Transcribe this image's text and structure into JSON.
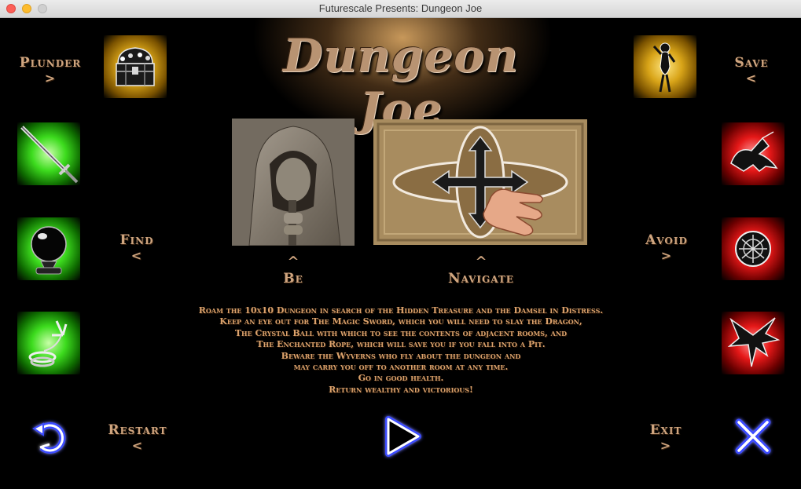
{
  "window": {
    "title": "Futurescale Presents: Dungeon Joe"
  },
  "game": {
    "title": "Dungeon Joe"
  },
  "labels": {
    "plunder": "Plunder",
    "plunder_arrow": ">",
    "save": "Save",
    "save_arrow": "<",
    "find": "Find",
    "find_arrow": "<",
    "avoid": "Avoid",
    "avoid_arrow": ">",
    "be": "Be",
    "be_caret": "^",
    "navigate": "Navigate",
    "navigate_caret": "^",
    "restart": "Restart",
    "restart_arrow": "<",
    "exit": "Exit",
    "exit_arrow": ">"
  },
  "intro_lines": [
    "Roam the 10x10 Dungeon in search of the Hidden Treasure and the Damsel in Distress.",
    "Keep an eye out for The Magic Sword, which you will need to slay the Dragon,",
    "The Crystal Ball with which to see the contents of adjacent rooms, and",
    "The Enchanted Rope, which will save you if you fall into a Pit.",
    "Beware the Wyverns who fly about the dungeon and",
    "may carry you off to another room at any time.",
    "Go in good health.",
    "Return wealthy and victorious!"
  ],
  "icons": {
    "treasure": "treasure-chest-icon",
    "damsel": "damsel-icon",
    "sword": "sword-icon",
    "crystal_ball": "crystal-ball-icon",
    "rope": "rope-icon",
    "dragon": "dragon-icon",
    "pit": "pit-icon",
    "wyvern": "wyvern-icon",
    "restart": "restart-icon",
    "play": "play-icon",
    "exit": "close-icon"
  },
  "colors": {
    "label": "#cfa57f",
    "intro_text": "#dba26c",
    "gold_glow": "#d8a418",
    "green_glow": "#3ddc1e",
    "red_glow": "#e51818",
    "blue_glow": "#2a3cff"
  }
}
